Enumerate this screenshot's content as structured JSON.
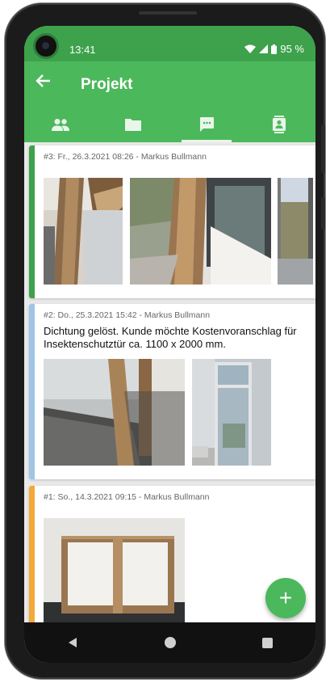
{
  "status": {
    "time": "13:41",
    "battery": "95 %"
  },
  "appbar": {
    "title": "Projekt"
  },
  "tabs": [
    {
      "icon": "people-icon",
      "active": false
    },
    {
      "icon": "folder-icon",
      "active": false
    },
    {
      "icon": "chat-icon",
      "active": true
    },
    {
      "icon": "contact-card-icon",
      "active": false
    }
  ],
  "entries": [
    {
      "meta": "#3: Fr., 26.3.2021 08:26 - Markus Bullmann",
      "text": "",
      "accent": "#3da24b"
    },
    {
      "meta": "#2: Do., 25.3.2021 15:42 - Markus Bullmann",
      "text": "Dichtung gelöst. Kunde möchte Kostenvoranschlag für Insektenschutztür ca. 1100 x 2000 mm.",
      "accent": "#9ec4e6"
    },
    {
      "meta": "#1: So., 14.3.2021 09:15 - Markus Bullmann",
      "text": "",
      "accent": "#f3a93a"
    }
  ],
  "fab": {
    "label": "+"
  }
}
